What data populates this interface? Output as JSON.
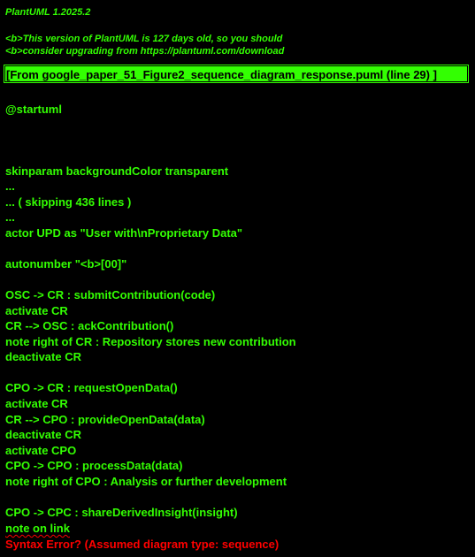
{
  "header": {
    "version": "PlantUML 1.2025.2",
    "warning_line1": "<b>This version of PlantUML is 127 days old, so you should",
    "warning_line2": "<b>consider upgrading from https://plantuml.com/download"
  },
  "banner": {
    "text": "[From google_paper_51_Figure2_sequence_diagram_response.puml (line 29) ]"
  },
  "source_lines": [
    "@startuml",
    "skinparam backgroundColor transparent",
    "...",
    "... ( skipping 436 lines )",
    "...",
    "actor UPD as \"User with\\nProprietary Data\"",
    "autonumber \"<b>[00]\"",
    "OSC -> CR : submitContribution(code)",
    "activate CR",
    "CR --> OSC : ackContribution()",
    "note right of CR : Repository stores new contribution",
    "deactivate CR",
    "CPO -> CR : requestOpenData()",
    "activate CR",
    "CR --> CPO : provideOpenData(data)",
    "deactivate CR",
    "activate CPO",
    "CPO -> CPO : processData(data)",
    "note right of CPO : Analysis or further development",
    "CPO -> CPC : shareDerivedInsight(insight)",
    "note on link"
  ],
  "error": {
    "text": " Syntax Error? (Assumed diagram type: sequence)"
  },
  "colors": {
    "background": "#000000",
    "text": "#33ff02",
    "banner_bg": "#33ff02",
    "error": "#ff0000"
  }
}
